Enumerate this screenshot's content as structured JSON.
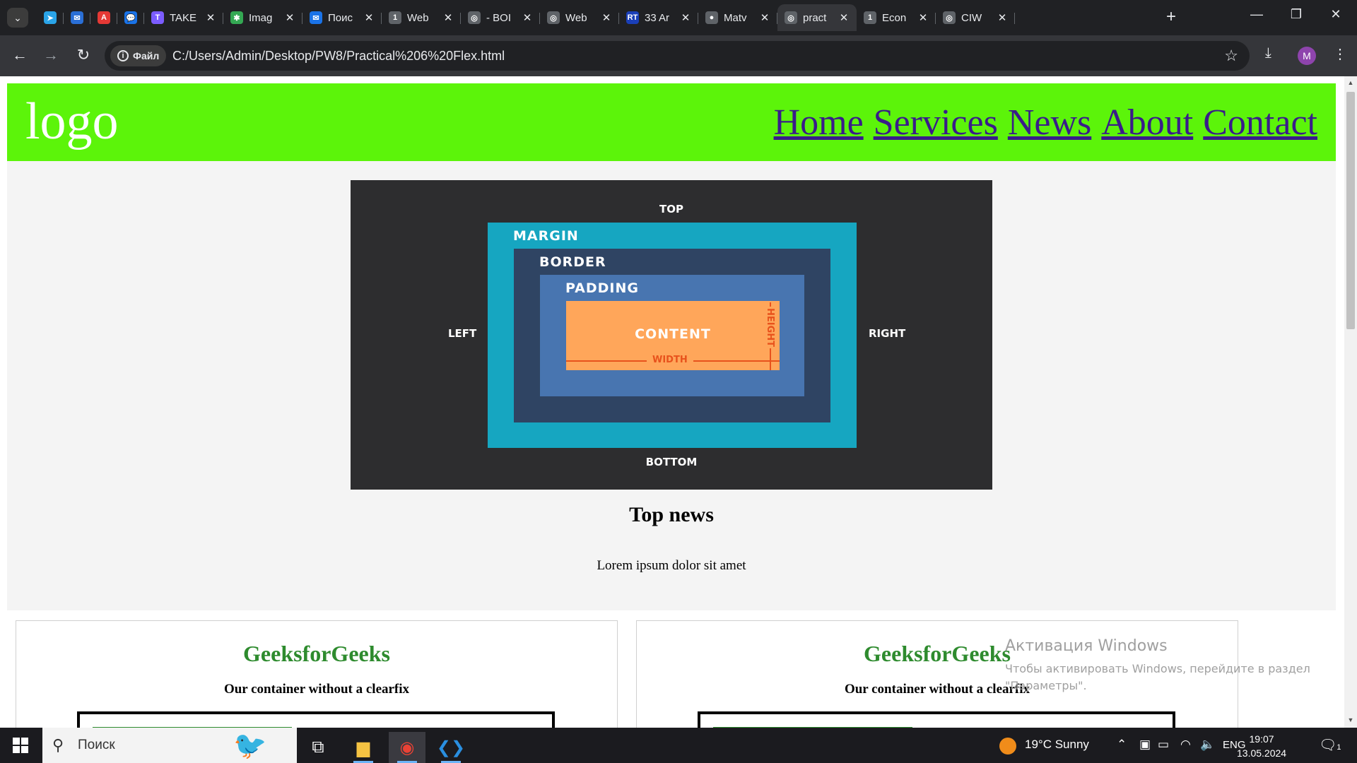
{
  "browser": {
    "tabs": [
      {
        "title": "",
        "favicon": "telegram-icon",
        "color": "#2aa4e8",
        "glyph": "➤"
      },
      {
        "title": "",
        "favicon": "mail-icon",
        "color": "#2a6fd6",
        "glyph": "✉"
      },
      {
        "title": "",
        "favicon": "app-icon",
        "color": "#e53935",
        "glyph": "A"
      },
      {
        "title": "",
        "favicon": "chat-icon",
        "color": "#1a73e8",
        "glyph": "💬"
      },
      {
        "title": "TAKE",
        "favicon": "take-icon",
        "color": "#7b5cff",
        "glyph": "T"
      },
      {
        "title": "Imag",
        "favicon": "image-icon",
        "color": "#34a853",
        "glyph": "✱"
      },
      {
        "title": "Поис",
        "favicon": "mail-search-icon",
        "color": "#1a73e8",
        "glyph": "✉"
      },
      {
        "title": "Web",
        "favicon": "doc-icon",
        "color": "#5f6368",
        "glyph": "1"
      },
      {
        "title": "- BOI",
        "favicon": "globe-icon",
        "color": "#5f6368",
        "glyph": "◎"
      },
      {
        "title": "Web",
        "favicon": "globe-icon",
        "color": "#5f6368",
        "glyph": "◎"
      },
      {
        "title": "33 Ar",
        "favicon": "rt-icon",
        "color": "#1a3fb8",
        "glyph": "RT"
      },
      {
        "title": "Matv",
        "favicon": "github-icon",
        "color": "#5f6368",
        "glyph": "●"
      },
      {
        "title": "pract",
        "favicon": "globe-icon",
        "color": "#5f6368",
        "glyph": "◎",
        "active": true
      },
      {
        "title": "Econ",
        "favicon": "doc-icon",
        "color": "#5f6368",
        "glyph": "1"
      },
      {
        "title": "CIW",
        "favicon": "globe-icon",
        "color": "#5f6368",
        "glyph": "◎"
      }
    ],
    "address": {
      "chip_label": "Файл",
      "url": "C:/Users/Admin/Desktop/PW8/Practical%206%20Flex.html"
    },
    "avatar_letter": "M"
  },
  "page": {
    "header": {
      "logo": "logo",
      "nav": [
        "Home",
        "Services",
        "News",
        "About",
        "Contact"
      ],
      "background": "#5cf40a"
    },
    "box_model": {
      "top": "TOP",
      "bottom": "BOTTOM",
      "left": "LEFT",
      "right": "RIGHT",
      "margin": "MARGIN",
      "border": "BORDER",
      "padding": "PADDING",
      "content": "CONTENT",
      "width": "WIDTH",
      "height": "HEIGHT"
    },
    "top_news": "Top news",
    "lorem": "Lorem ipsum dolor sit amet",
    "cards": [
      {
        "title": "GeeksforGeeks",
        "subtitle": "Our container without a clearfix"
      },
      {
        "title": "GeeksforGeeks",
        "subtitle": "Our container without a clearfix"
      }
    ]
  },
  "windows_activation": {
    "title": "Активация Windows",
    "body": "Чтобы активировать Windows, перейдите в раздел \"Параметры\"."
  },
  "taskbar": {
    "search_label": "Поиск",
    "weather": "19°C  Sunny",
    "lang": "ENG",
    "time": "19:07",
    "date": "13.05.2024",
    "notification_count": "1"
  }
}
